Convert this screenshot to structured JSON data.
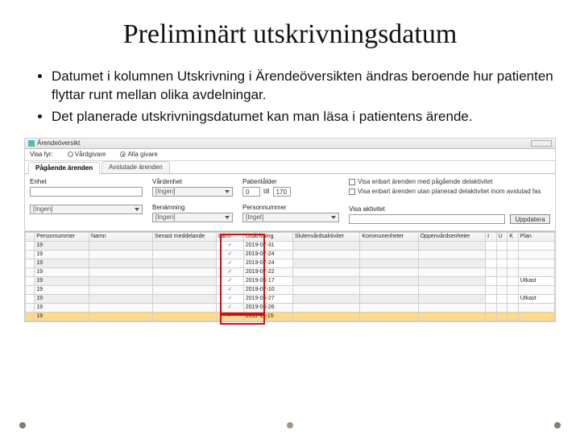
{
  "title": "Preliminärt utskrivningsdatum",
  "bullets": [
    "Datumet i kolumnen Utskrivning i Ärendeöversikten ändras beroende hur patienten flyttar runt mellan olika avdelningar.",
    "Det planerade utskrivningsdatumet kan man läsa i patientens ärende."
  ],
  "app": {
    "window_title": "Ärendeöversikt",
    "visa_label": "Visa fyr:",
    "radios": [
      {
        "label": "Vårdgivare",
        "checked": false
      },
      {
        "label": "Alla givare",
        "checked": true
      }
    ],
    "tabs": [
      {
        "label": "Pågående ärenden",
        "active": true
      },
      {
        "label": "Avslutade ärenden",
        "active": false
      }
    ],
    "filters": {
      "enhet": {
        "label": "Enhet",
        "value": "",
        "sel_placeholder": "[Ingen]"
      },
      "vardenhet": {
        "label": "Vårdenhet",
        "value_placeholder": "[Ingen]",
        "sel_placeholder": "[Ingen]"
      },
      "patientalder": {
        "label": "Patientålder",
        "from": "0",
        "to": "till",
        "to_val": "170"
      },
      "benamning": {
        "label": "Benämning",
        "value": ""
      },
      "personnummer": {
        "label": "Personnummer",
        "placeholder": "[Inget]"
      },
      "checks": [
        "Visa enbart ärenden med pågående delaktivitet",
        "Visa enbart ärenden utan planerad delaktivitet inom avslutad fas"
      ],
      "visa_aktivitet": {
        "label": "Visa aktivitet",
        "button": "Uppdatera"
      }
    },
    "columns": [
      "",
      "Personnummer",
      "Namn",
      "Senast meddelande",
      "Larm",
      "Utskrivning",
      "Slutenvårdsaktivitet",
      "Kommunenheter",
      "Öppenvårdsenheter",
      "I",
      "U",
      "K",
      "Plan"
    ],
    "rows": [
      {
        "pn": "19",
        "chk": "✓",
        "date": "2019-07-31",
        "plan": ""
      },
      {
        "pn": "19",
        "chk": "✓",
        "date": "2019-07-24",
        "plan": ""
      },
      {
        "pn": "19",
        "chk": "✓",
        "date": "2019-07-24",
        "plan": ""
      },
      {
        "pn": "19",
        "chk": "✓",
        "date": "2019-07-22",
        "plan": ""
      },
      {
        "pn": "19",
        "chk": "✓",
        "date": "2019-06-17",
        "plan": "Utkast"
      },
      {
        "pn": "19",
        "chk": "✓",
        "date": "2019-07-10",
        "plan": ""
      },
      {
        "pn": "19",
        "chk": "✓",
        "date": "2019-06-27",
        "plan": "Utkast"
      },
      {
        "pn": "19",
        "chk": "✓",
        "date": "2019-06-26",
        "plan": "",
        "sel": false
      },
      {
        "pn": "19",
        "chk": "✓",
        "date": "2011-11-15",
        "plan": "",
        "sel": true
      }
    ]
  }
}
